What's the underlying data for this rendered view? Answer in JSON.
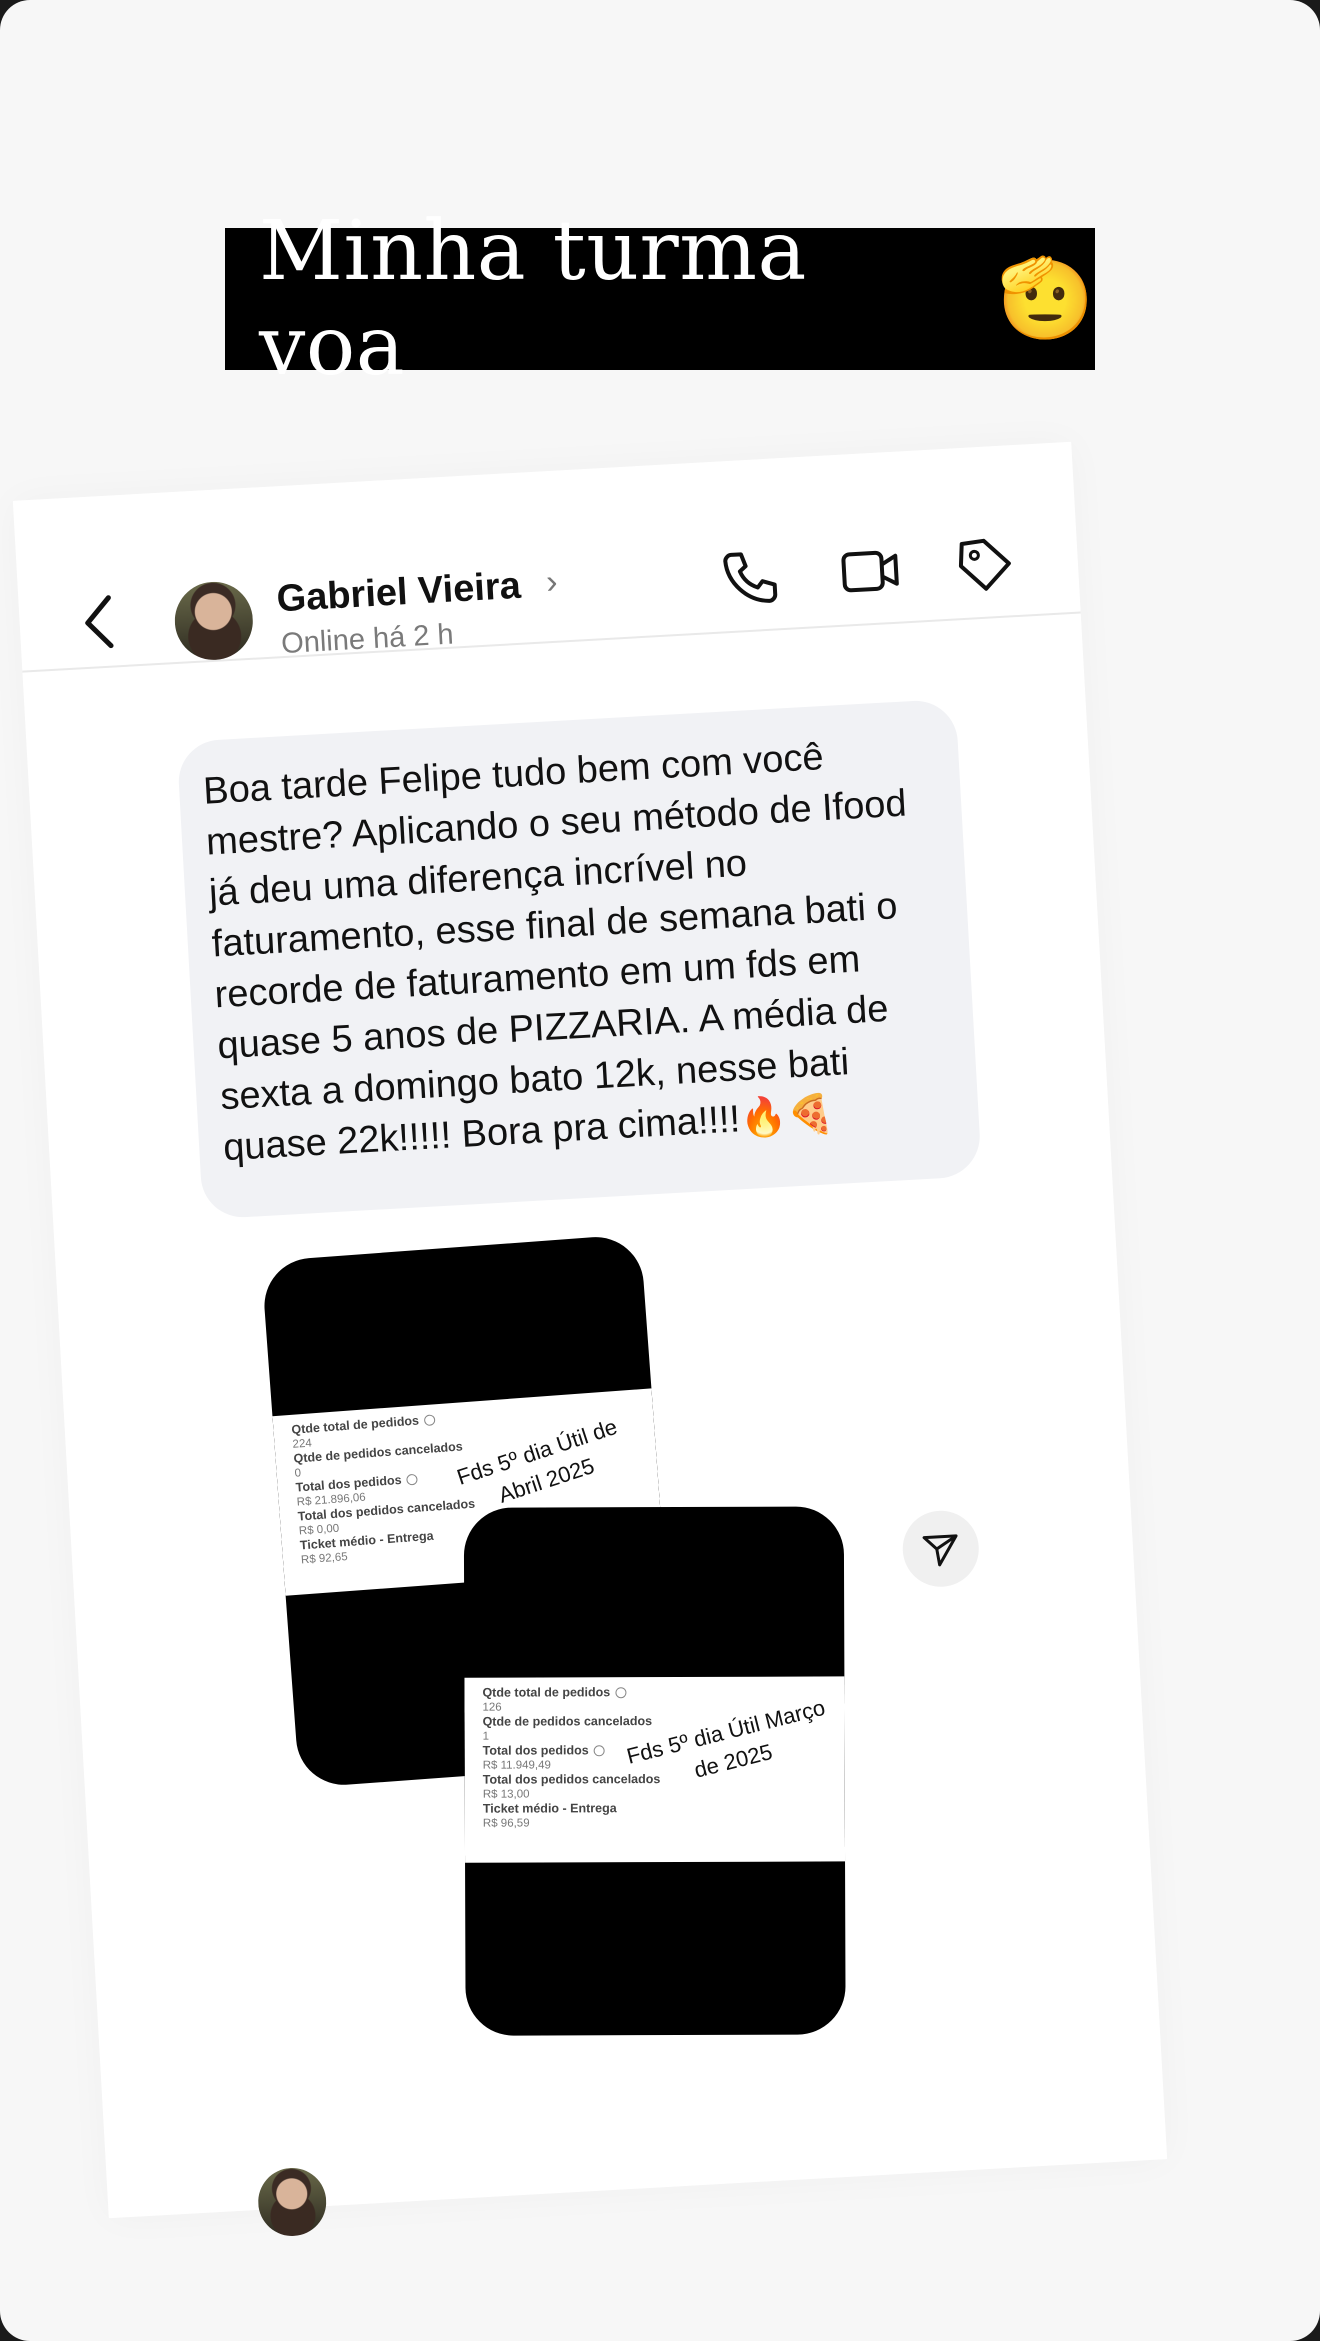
{
  "story": {
    "caption": "Minha turma voa",
    "caption_emoji": "🫡"
  },
  "header": {
    "contact_name": "Gabriel Vieira",
    "status": "Online há 2 h",
    "icons": [
      "back-icon",
      "phone-icon",
      "video-camera-icon",
      "tag-icon"
    ]
  },
  "message": {
    "text": "Boa tarde Felipe tudo bem com você mestre? Aplicando o seu método de Ifood já deu uma diferença incrível no faturamento, esse final de semana bati o recorde de faturamento em um fds em quase 5 anos de PIZZARIA. A média de sexta a domingo bato 12k, nesse bati quase 22k!!!!!  Bora pra cima!!!!🔥🍕"
  },
  "attachments": [
    {
      "note": "Fds 5º dia Útil de Abril 2025",
      "rows": [
        {
          "label": "Qtde total de pedidos",
          "value": "224",
          "info": true
        },
        {
          "label": "Qtde de pedidos cancelados",
          "value": "0",
          "info": false
        },
        {
          "label": "Total dos pedidos",
          "value": "R$ 21.896,06",
          "info": true
        },
        {
          "label": "Total dos pedidos cancelados",
          "value": "R$ 0,00",
          "info": false
        },
        {
          "label": "Ticket médio - Entrega",
          "value": "R$ 92,65",
          "info": false
        }
      ]
    },
    {
      "note": "Fds 5º dia Útil Março de 2025",
      "rows": [
        {
          "label": "Qtde total de pedidos",
          "value": "126",
          "info": true
        },
        {
          "label": "Qtde de pedidos cancelados",
          "value": "1",
          "info": false
        },
        {
          "label": "Total dos pedidos",
          "value": "R$ 11.949,49",
          "info": true
        },
        {
          "label": "Total dos pedidos cancelados",
          "value": "R$ 13,00",
          "info": false
        },
        {
          "label": "Ticket médio - Entrega",
          "value": "R$ 96,59",
          "info": false
        }
      ]
    }
  ],
  "share_icon": "send-icon"
}
